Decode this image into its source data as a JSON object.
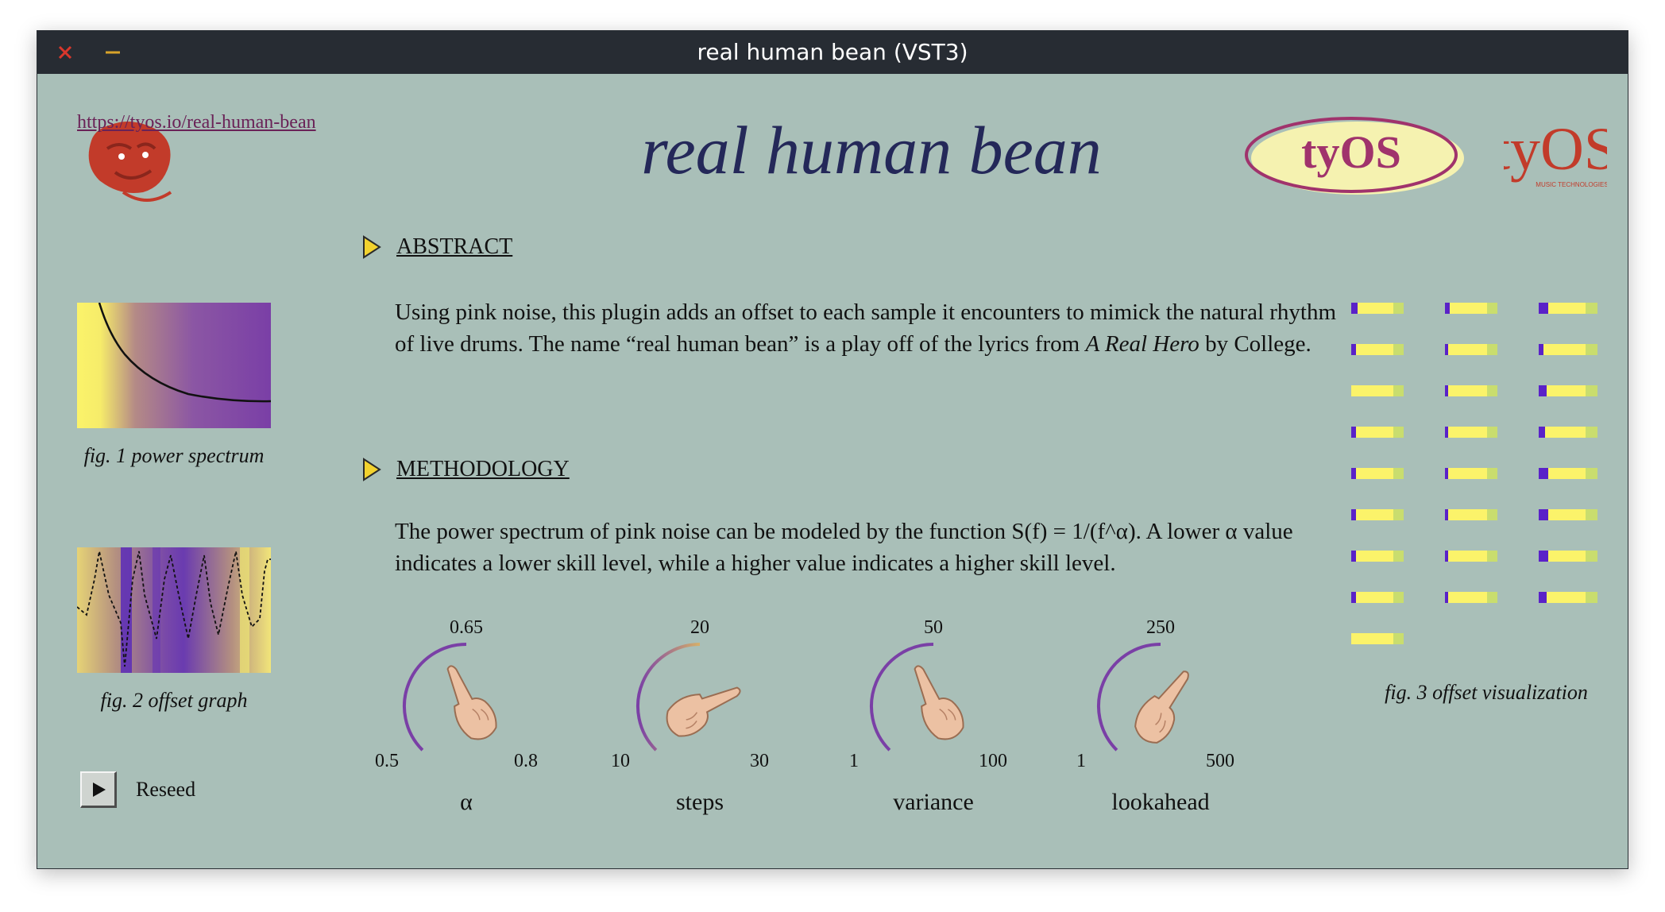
{
  "window": {
    "title": "real human bean (VST3)"
  },
  "header": {
    "url": "https://tyos.io/real-human-bean",
    "title": "real human bean",
    "oval_logo_text": "tyOS",
    "brand_logo_text": "tyOS",
    "brand_logo_subtext": "MUSIC TECHNOLOGIES"
  },
  "figures": {
    "fig1_caption": "fig. 1 power spectrum",
    "fig2_caption": "fig. 2 offset graph",
    "fig3_caption": "fig. 3 offset visualization"
  },
  "sections": {
    "abstract": {
      "heading": "ABSTRACT",
      "text_main": "Using pink noise, this plugin adds an offset to each sample it encounters to mimick the natural rhythm of live drums. The name “real human bean” is a play off of the lyrics from ",
      "text_italic": "A Real Hero",
      "text_tail": " by College."
    },
    "methodology": {
      "heading": "METHODOLOGY",
      "text": "The power spectrum of pink noise can be modeled by the function S(f) = 1/(f^α). A lower α value indicates a lower skill level, while a higher value indicates a higher skill level."
    }
  },
  "knobs": [
    {
      "name": "α",
      "min": "0.5",
      "max": "0.8",
      "value": "0.65",
      "fraction": 0.5
    },
    {
      "name": "steps",
      "min": "10",
      "max": "30",
      "value": "20",
      "fraction": 0.5
    },
    {
      "name": "variance",
      "min": "1",
      "max": "100",
      "value": "50",
      "fraction": 0.5
    },
    {
      "name": "lookahead",
      "min": "1",
      "max": "500",
      "value": "250",
      "fraction": 0.5
    }
  ],
  "reseed": {
    "label": "Reseed"
  },
  "colors": {
    "background": "#a9bfb8",
    "titlebar": "#272c33",
    "title_text": "#242859",
    "url": "#6a2257",
    "accent_purple": "#7a3fa6",
    "yellow": "#fbf36a",
    "logo_red": "#c23b2a"
  }
}
